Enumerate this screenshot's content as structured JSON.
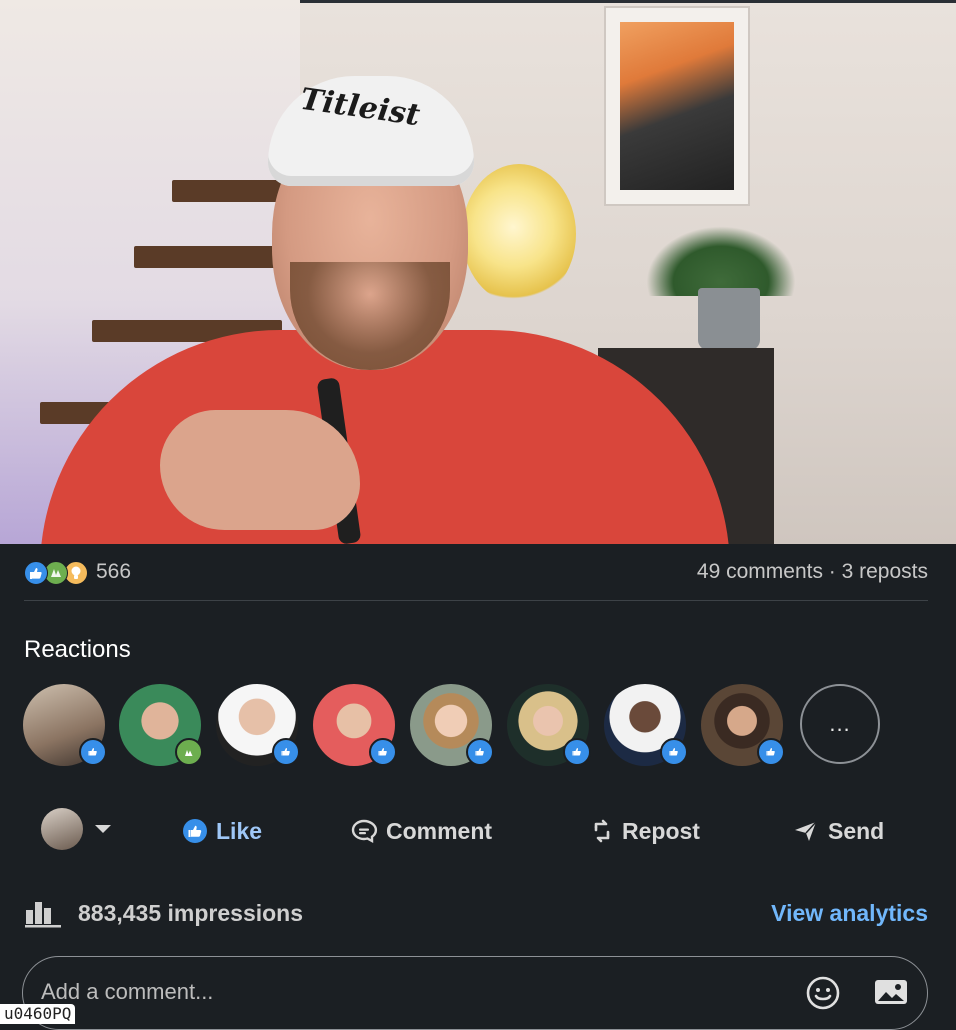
{
  "post": {
    "reactions_count": "566",
    "comments_reposts": "49 comments · 3 reposts"
  },
  "reactions_section": {
    "title": "Reactions",
    "more_label": "..."
  },
  "video": {
    "cap_text": "Titleist"
  },
  "actions": {
    "like": "Like",
    "comment": "Comment",
    "repost": "Repost",
    "send": "Send"
  },
  "impressions": {
    "text": "883,435 impressions",
    "link": "View analytics"
  },
  "comment_input": {
    "placeholder": "Add a comment..."
  },
  "corner_label": "u0460PQ",
  "colors": {
    "background": "#1b1f23",
    "like_blue": "#378fe9",
    "link_blue": "#71b7fb"
  }
}
